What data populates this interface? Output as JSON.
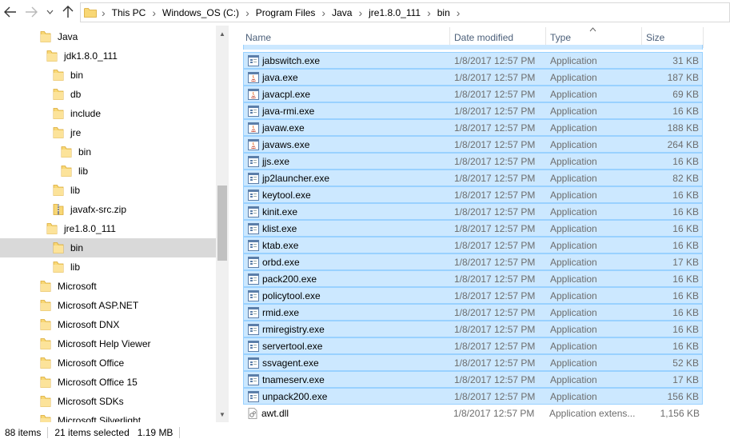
{
  "address": {
    "crumbs": [
      "This PC",
      "Windows_OS (C:)",
      "Program Files",
      "Java",
      "jre1.8.0_111",
      "bin"
    ]
  },
  "nav": {
    "items": [
      {
        "label": "Java",
        "indent": 0
      },
      {
        "label": "jdk1.8.0_111",
        "indent": 1
      },
      {
        "label": "bin",
        "indent": 2
      },
      {
        "label": "db",
        "indent": 2
      },
      {
        "label": "include",
        "indent": 2
      },
      {
        "label": "jre",
        "indent": 2
      },
      {
        "label": "bin",
        "indent": 3
      },
      {
        "label": "lib",
        "indent": 3
      },
      {
        "label": "lib",
        "indent": 2
      },
      {
        "label": "javafx-src.zip",
        "indent": 2,
        "zip": true
      },
      {
        "label": "jre1.8.0_111",
        "indent": 1
      },
      {
        "label": "bin",
        "indent": 2,
        "selected": true
      },
      {
        "label": "lib",
        "indent": 2
      },
      {
        "label": "Microsoft",
        "indent": 0
      },
      {
        "label": "Microsoft ASP.NET",
        "indent": 0
      },
      {
        "label": "Microsoft DNX",
        "indent": 0
      },
      {
        "label": "Microsoft Help Viewer",
        "indent": 0
      },
      {
        "label": "Microsoft Office",
        "indent": 0
      },
      {
        "label": "Microsoft Office 15",
        "indent": 0
      },
      {
        "label": "Microsoft SDKs",
        "indent": 0
      },
      {
        "label": "Microsoft Silverlight",
        "indent": 0
      }
    ]
  },
  "columns": {
    "name": "Name",
    "date": "Date modified",
    "type": "Type",
    "size": "Size"
  },
  "files": [
    {
      "name": "jabswitch.exe",
      "date": "1/8/2017 12:57 PM",
      "type": "Application",
      "size": "31 KB",
      "selected": true,
      "icon": "exe"
    },
    {
      "name": "java.exe",
      "date": "1/8/2017 12:57 PM",
      "type": "Application",
      "size": "187 KB",
      "selected": true,
      "icon": "java"
    },
    {
      "name": "javacpl.exe",
      "date": "1/8/2017 12:57 PM",
      "type": "Application",
      "size": "69 KB",
      "selected": true,
      "icon": "java"
    },
    {
      "name": "java-rmi.exe",
      "date": "1/8/2017 12:57 PM",
      "type": "Application",
      "size": "16 KB",
      "selected": true,
      "icon": "exe"
    },
    {
      "name": "javaw.exe",
      "date": "1/8/2017 12:57 PM",
      "type": "Application",
      "size": "188 KB",
      "selected": true,
      "icon": "java"
    },
    {
      "name": "javaws.exe",
      "date": "1/8/2017 12:57 PM",
      "type": "Application",
      "size": "264 KB",
      "selected": true,
      "icon": "java"
    },
    {
      "name": "jjs.exe",
      "date": "1/8/2017 12:57 PM",
      "type": "Application",
      "size": "16 KB",
      "selected": true,
      "icon": "exe"
    },
    {
      "name": "jp2launcher.exe",
      "date": "1/8/2017 12:57 PM",
      "type": "Application",
      "size": "82 KB",
      "selected": true,
      "icon": "exe"
    },
    {
      "name": "keytool.exe",
      "date": "1/8/2017 12:57 PM",
      "type": "Application",
      "size": "16 KB",
      "selected": true,
      "icon": "exe"
    },
    {
      "name": "kinit.exe",
      "date": "1/8/2017 12:57 PM",
      "type": "Application",
      "size": "16 KB",
      "selected": true,
      "icon": "exe"
    },
    {
      "name": "klist.exe",
      "date": "1/8/2017 12:57 PM",
      "type": "Application",
      "size": "16 KB",
      "selected": true,
      "icon": "exe"
    },
    {
      "name": "ktab.exe",
      "date": "1/8/2017 12:57 PM",
      "type": "Application",
      "size": "16 KB",
      "selected": true,
      "icon": "exe"
    },
    {
      "name": "orbd.exe",
      "date": "1/8/2017 12:57 PM",
      "type": "Application",
      "size": "17 KB",
      "selected": true,
      "icon": "exe"
    },
    {
      "name": "pack200.exe",
      "date": "1/8/2017 12:57 PM",
      "type": "Application",
      "size": "16 KB",
      "selected": true,
      "icon": "exe"
    },
    {
      "name": "policytool.exe",
      "date": "1/8/2017 12:57 PM",
      "type": "Application",
      "size": "16 KB",
      "selected": true,
      "icon": "exe"
    },
    {
      "name": "rmid.exe",
      "date": "1/8/2017 12:57 PM",
      "type": "Application",
      "size": "16 KB",
      "selected": true,
      "icon": "exe"
    },
    {
      "name": "rmiregistry.exe",
      "date": "1/8/2017 12:57 PM",
      "type": "Application",
      "size": "16 KB",
      "selected": true,
      "icon": "exe"
    },
    {
      "name": "servertool.exe",
      "date": "1/8/2017 12:57 PM",
      "type": "Application",
      "size": "16 KB",
      "selected": true,
      "icon": "exe"
    },
    {
      "name": "ssvagent.exe",
      "date": "1/8/2017 12:57 PM",
      "type": "Application",
      "size": "52 KB",
      "selected": true,
      "icon": "exe"
    },
    {
      "name": "tnameserv.exe",
      "date": "1/8/2017 12:57 PM",
      "type": "Application",
      "size": "17 KB",
      "selected": true,
      "icon": "exe"
    },
    {
      "name": "unpack200.exe",
      "date": "1/8/2017 12:57 PM",
      "type": "Application",
      "size": "156 KB",
      "selected": true,
      "icon": "exe"
    },
    {
      "name": "awt.dll",
      "date": "1/8/2017 12:57 PM",
      "type": "Application extens...",
      "size": "1,156 KB",
      "selected": false,
      "icon": "dll"
    }
  ],
  "status": {
    "count": "88 items",
    "selected": "21 items selected",
    "size": "1.19 MB"
  },
  "colors": {
    "selection_bg": "#cce8ff",
    "selection_border": "#99d1ff",
    "folder": "#f8d775",
    "header_text": "#4c607a"
  }
}
